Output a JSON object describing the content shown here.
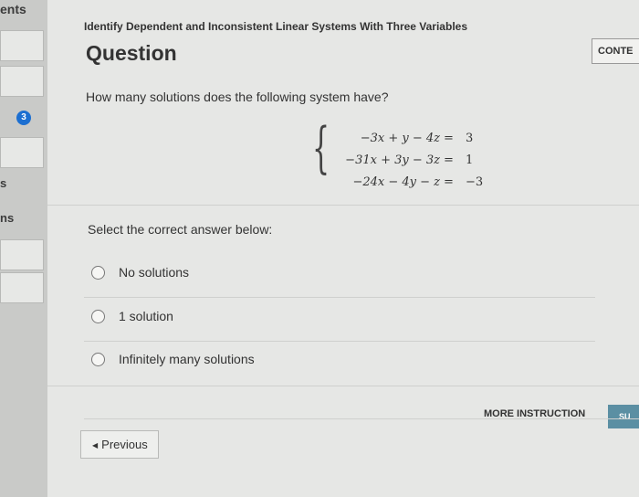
{
  "sidebar": {
    "title_fragment": "ents",
    "badge": "3",
    "fragment_s": "s",
    "fragment_ns": "ns"
  },
  "header": {
    "title": "Identify Dependent and Inconsistent Linear Systems With Three Variables",
    "content_button": "CONTE"
  },
  "question": {
    "heading": "Question",
    "prompt": "How many solutions does the following system have?",
    "system": [
      {
        "lhs": "−3x + y − 4z",
        "sign": "=",
        "rhs": "3"
      },
      {
        "lhs": "−31x + 3y − 3z",
        "sign": "=",
        "rhs": "1"
      },
      {
        "lhs": "−24x − 4y − z",
        "sign": "=",
        "rhs": "−3"
      }
    ]
  },
  "answer": {
    "select_label": "Select the correct answer below:",
    "options": [
      {
        "label": "No solutions"
      },
      {
        "label": "1 solution"
      },
      {
        "label": "Infinitely many solutions"
      }
    ]
  },
  "footer": {
    "more_instruction": "MORE INSTRUCTION",
    "submit": "SU",
    "previous": "Previous"
  },
  "colors": {
    "badge": "#1c6fd1",
    "submit": "#5b8fa3"
  }
}
